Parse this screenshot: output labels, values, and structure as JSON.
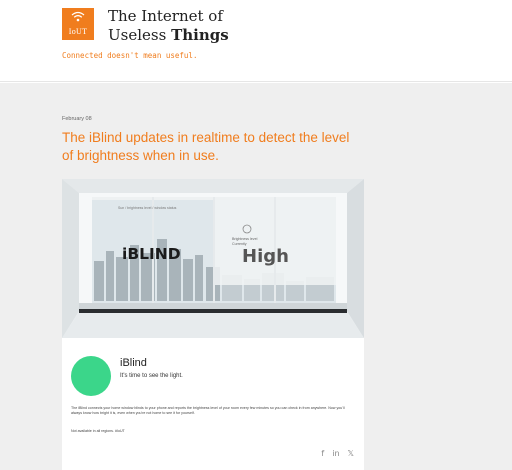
{
  "header": {
    "logo_abbr": "IoUT",
    "logo_icon": "wifi-icon",
    "title_line1": "The Internet of",
    "title_line2_regular": "Useless ",
    "title_line2_bold": "Things",
    "tagline": "Connected doesn't mean useful."
  },
  "post": {
    "date": "February 08",
    "title": "The iBlind updates in realtime to detect the level of brightness when in use."
  },
  "hero": {
    "blind_caption": "Sun / brightness level / window status",
    "brand": "iBLIND",
    "level_caption": "Brightness level",
    "level_sub": "Currently",
    "level": "High"
  },
  "product": {
    "name": "iBlind",
    "tagline": "It's time to see the light.",
    "description": "The iBlind connects your home window blinds to your phone and reports the brightness level of your room every few minutes so you can check in from anywhere. Now you'll always know how bright it is, even when you're not home to see it for yourself.",
    "by_line": "Not available in all regions. #IoUT"
  },
  "social": [
    {
      "name": "facebook-icon",
      "glyph": "f"
    },
    {
      "name": "linkedin-icon",
      "glyph": "in"
    },
    {
      "name": "twitter-icon",
      "glyph": "𝕏"
    }
  ],
  "colors": {
    "accent": "#f07d1e",
    "avatar": "#3bd68a",
    "page_bg": "#efefef"
  }
}
